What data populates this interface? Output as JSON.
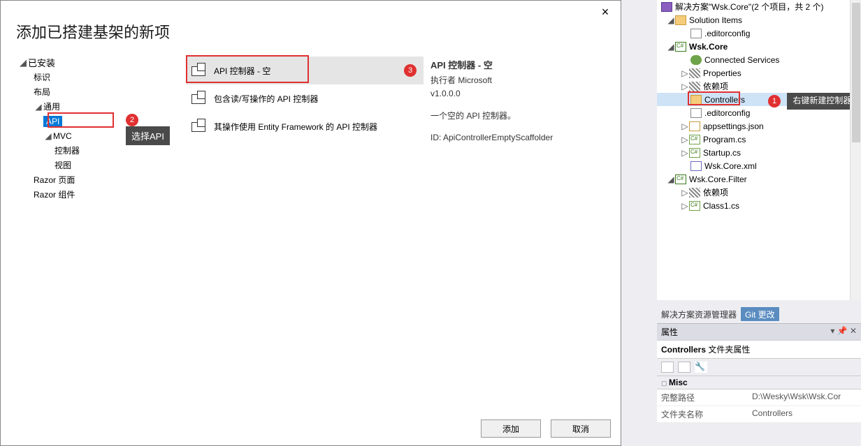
{
  "dialog": {
    "title": "添加已搭建基架的新项",
    "close": "×",
    "nav": {
      "installed": "已安装",
      "items": {
        "identity": "标识",
        "layout": "布局",
        "common": "通用",
        "api": "API",
        "mvc": "MVC",
        "controller": "控制器",
        "view": "视图",
        "razor_page": "Razor 页面",
        "razor_component": "Razor 组件"
      }
    },
    "badge2": "2",
    "tooltip2": "选择API",
    "list": [
      {
        "label": "API 控制器 - 空",
        "selected": true,
        "badge": "3",
        "hl": true
      },
      {
        "label": "包含读/写操作的 API 控制器",
        "selected": false
      },
      {
        "label": "其操作使用 Entity Framework 的 API 控制器",
        "selected": false
      }
    ],
    "detail": {
      "title": "API 控制器 - 空",
      "author": "执行者 Microsoft",
      "version": "v1.0.0.0",
      "desc": "一个空的 API 控制器。",
      "id": "ID: ApiControllerEmptyScaffolder"
    },
    "buttons": {
      "ok": "添加",
      "cancel": "取消"
    }
  },
  "sln": {
    "root": "解决方案\"Wsk.Core\"(2 个项目，共 2 个)",
    "solution_items": "Solution Items",
    "editorconfig": ".editorconfig",
    "proj1": "Wsk.Core",
    "connected_services": "Connected Services",
    "properties": "Properties",
    "deps": "依赖项",
    "controllers": "Controllers",
    "badge1": "1",
    "tooltip1": "右键新建控制器",
    "editorconfig2": ".editorconfig",
    "appsettings": "appsettings.json",
    "program": "Program.cs",
    "startup": "Startup.cs",
    "wskxml": "Wsk.Core.xml",
    "proj2": "Wsk.Core.Filter",
    "deps2": "依赖项",
    "class1": "Class1.cs"
  },
  "sln_tabs": {
    "t1": "解决方案资源管理器",
    "t2": "Git 更改"
  },
  "props": {
    "header": "属性",
    "sub_bold": "Controllers",
    "sub_rest": " 文件夹属性",
    "cat": "Misc",
    "rows": [
      {
        "k": "完整路径",
        "v": "D:\\Wesky\\Wsk\\Wsk.Cor"
      },
      {
        "k": "文件夹名称",
        "v": "Controllers"
      }
    ]
  }
}
